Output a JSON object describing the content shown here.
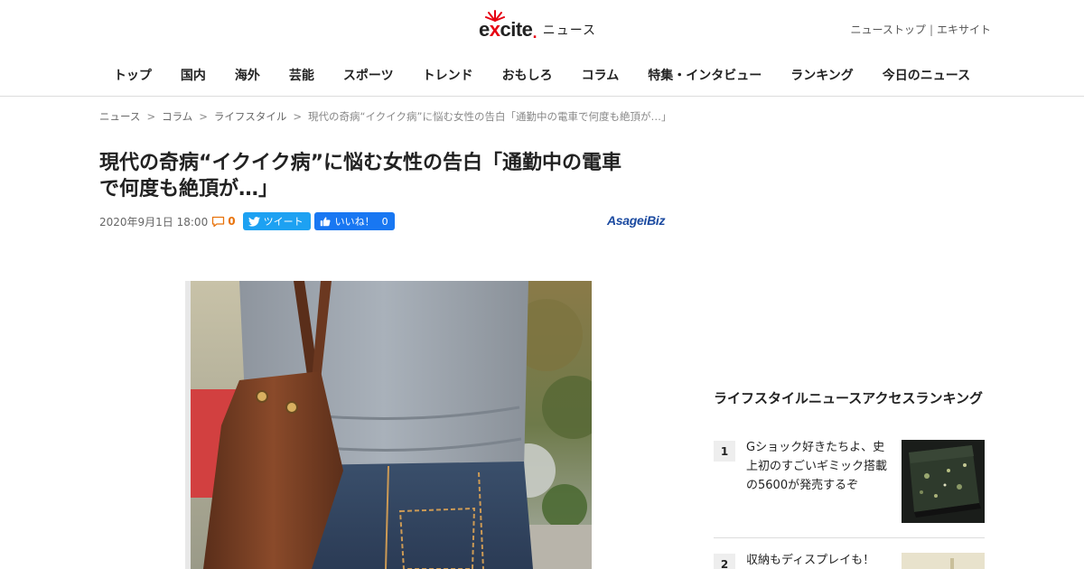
{
  "header": {
    "logo_text_pre": "e",
    "logo_text_x": "x",
    "logo_text_post": "cite",
    "logo_dot": ".",
    "logo_section": "ニュース",
    "links": [
      "ニューストップ",
      "エキサイト"
    ],
    "link_separator": "|"
  },
  "nav": {
    "items": [
      "トップ",
      "国内",
      "海外",
      "芸能",
      "スポーツ",
      "トレンド",
      "おもしろ",
      "コラム",
      "特集・インタビュー",
      "ランキング",
      "今日のニュース"
    ]
  },
  "breadcrumb": {
    "items": [
      "ニュース",
      "コラム",
      "ライフスタイル"
    ],
    "separator": ">",
    "current": "現代の奇病“イクイク病”に悩む女性の告白「通勤中の電車で何度も絶頂が…」"
  },
  "article": {
    "title_line1": "現代の奇病“イクイク病”に悩む女性の告白「通勤中の電車",
    "title_line2": "で何度も絶頂が…」",
    "date": "2020年9月1日 18:00",
    "comment_count": "0",
    "tweet_label": "ツイート",
    "like_label": "いいね！",
    "like_count": "0",
    "source": "AsageiBiz"
  },
  "sidebar": {
    "ranking_title": "ライフスタイルニュースアクセスランキング",
    "items": [
      {
        "rank": "1",
        "text": "Gショック好きたちよ、史上初のすごいギミック搭載の5600が発売するぞ"
      },
      {
        "rank": "2",
        "text": "収納もディスプレイも！"
      }
    ]
  },
  "colors": {
    "brand_red": "#e60012",
    "twitter": "#1da1f2",
    "facebook": "#1877f2",
    "comment": "#e8730c",
    "source": "#1b4aa0"
  }
}
